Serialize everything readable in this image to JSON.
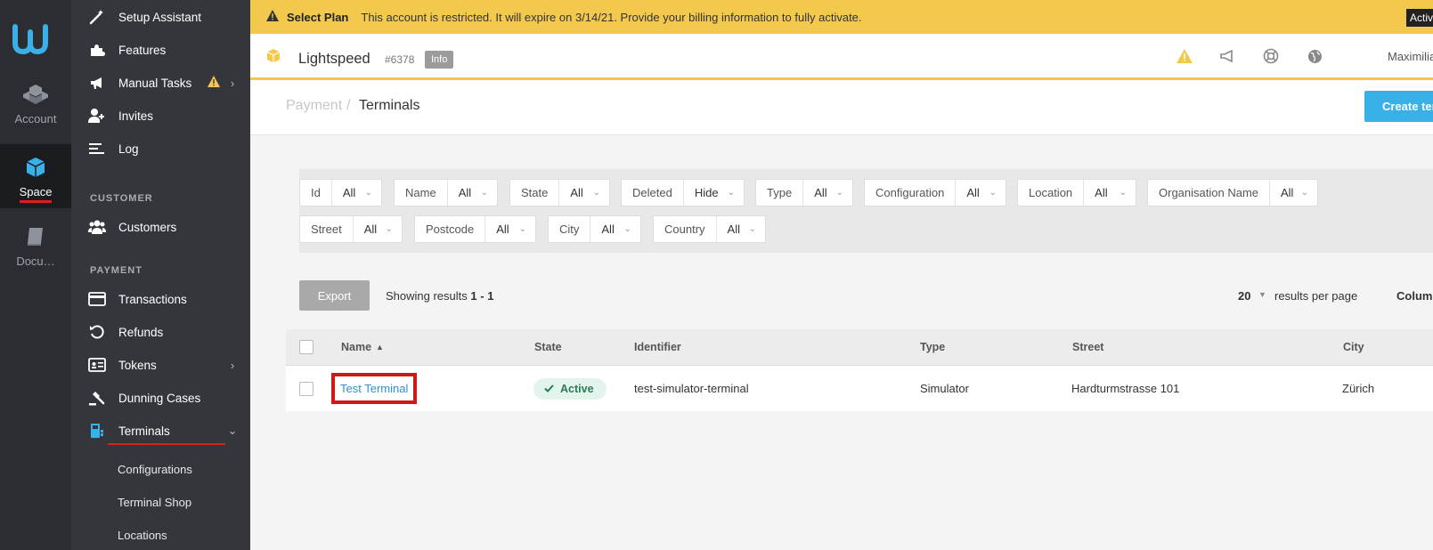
{
  "rail": {
    "items": [
      {
        "label": "Account",
        "icon": "cubes-icon"
      },
      {
        "label": "Space",
        "icon": "cube-icon",
        "active": true
      },
      {
        "label": "Docu…",
        "icon": "book-icon"
      }
    ]
  },
  "menu": {
    "items": [
      {
        "label": "Setup Assistant",
        "icon": "magic-wand-icon"
      },
      {
        "label": "Features",
        "icon": "puzzle-icon"
      },
      {
        "label": "Manual Tasks",
        "icon": "megaphone-icon"
      },
      {
        "label": "Invites",
        "icon": "user-plus-icon"
      },
      {
        "label": "Log",
        "icon": "list-icon"
      }
    ],
    "customer_section": "CUSTOMER",
    "customers_label": "Customers",
    "payment_section": "PAYMENT",
    "payment_items": [
      {
        "label": "Transactions",
        "icon": "credit-card-icon"
      },
      {
        "label": "Refunds",
        "icon": "undo-icon"
      },
      {
        "label": "Tokens",
        "icon": "id-card-icon"
      },
      {
        "label": "Dunning Cases",
        "icon": "gavel-icon"
      },
      {
        "label": "Terminals",
        "icon": "terminal-icon",
        "active": true
      }
    ],
    "terminal_subitems": [
      "Configurations",
      "Terminal Shop",
      "Locations"
    ]
  },
  "banner": {
    "title": "Select Plan",
    "text": "This account is restricted. It will expire on 3/14/21. Provide your billing information to fully activate.",
    "activate": "Activate"
  },
  "topbar": {
    "space_name": "Lightspeed",
    "space_id": "#6378",
    "info_badge": "Info",
    "user_name": "Maximilian"
  },
  "breadcrumb": {
    "parent": "Payment",
    "separator": "/",
    "current": "Terminals"
  },
  "create_button": "Create terminal",
  "filters": [
    {
      "label": "Id",
      "value": "All"
    },
    {
      "label": "Name",
      "value": "All"
    },
    {
      "label": "State",
      "value": "All"
    },
    {
      "label": "Deleted",
      "value": "Hide"
    },
    {
      "label": "Type",
      "value": "All"
    },
    {
      "label": "Configuration",
      "value": "All"
    },
    {
      "label": "Location",
      "value": "All"
    },
    {
      "label": "Organisation Name",
      "value": "All"
    },
    {
      "label": "Street",
      "value": "All"
    },
    {
      "label": "Postcode",
      "value": "All"
    },
    {
      "label": "City",
      "value": "All"
    },
    {
      "label": "Country",
      "value": "All"
    }
  ],
  "toolbar": {
    "export": "Export",
    "showing_prefix": "Showing results",
    "showing_range": "1 - 1",
    "per_page_value": "20",
    "per_page_label": "results per page",
    "columns": "Columns"
  },
  "table": {
    "columns": [
      "Name",
      "State",
      "Identifier",
      "Type",
      "Street",
      "City"
    ],
    "rows": [
      {
        "name": "Test Terminal",
        "state": "Active",
        "identifier": "test-simulator-terminal",
        "type": "Simulator",
        "street": "Hardturmstrasse 101",
        "city": "Zürich"
      }
    ]
  },
  "colors": {
    "banner": "#f3c94d",
    "primary_button": "#3ab0e8",
    "link": "#2b93d1",
    "active_badge_bg": "#e3f4ed",
    "highlight": "#d01818"
  }
}
